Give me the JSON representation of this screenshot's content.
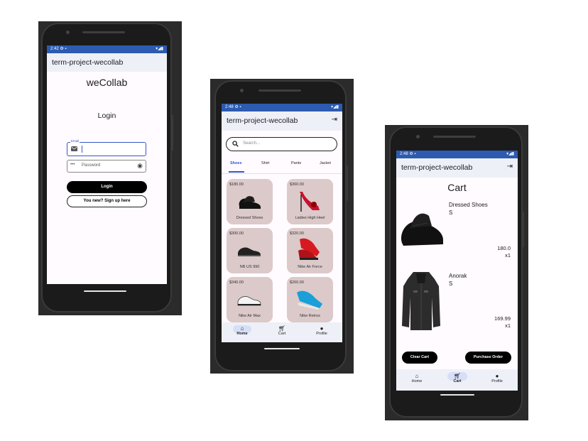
{
  "login_screen": {
    "status_time": "2:42",
    "status_icons": "▾◢▮",
    "app_title": "term-project-wecollab",
    "brand": "weCollab",
    "heading": "Login",
    "email_label": "Email",
    "password_placeholder": "Password",
    "login_button": "Login",
    "signup_button": "You new? Sign up here"
  },
  "shop_screen": {
    "status_time": "2:48",
    "status_icons": "▾◢▮",
    "app_title": "term-project-wecollab",
    "search_placeholder": "Search...",
    "tabs": [
      "Shoes",
      "Shirt",
      "Pants",
      "Jacket"
    ],
    "products": [
      {
        "price": "$180.00",
        "name": "Dressed Shoes"
      },
      {
        "price": "$360.00",
        "name": "Ladies High Heel"
      },
      {
        "price": "$300.00",
        "name": "NB US 990"
      },
      {
        "price": "$320.00",
        "name": "Nike Air Force"
      },
      {
        "price": "$340.00",
        "name": "Nike Air Max"
      },
      {
        "price": "$260.00",
        "name": "Nike Retros"
      }
    ],
    "nav": [
      "Home",
      "Cart",
      "Profile"
    ],
    "active_nav": "Home"
  },
  "cart_screen": {
    "status_time": "2:48",
    "status_icons": "▾◢▮",
    "app_title": "term-project-wecollab",
    "heading": "Cart",
    "items": [
      {
        "name": "Dressed Shoes",
        "size": "S",
        "price": "180.0",
        "qty": "x1"
      },
      {
        "name": "Anorak",
        "size": "S",
        "price": "169.99",
        "qty": "x1"
      }
    ],
    "clear_button": "Clear Cart",
    "purchase_button": "Purchase Order",
    "nav": [
      "Home",
      "Cart",
      "Profile"
    ],
    "active_nav": "Cart"
  },
  "colors": {
    "statusbar": "#2c5bb0",
    "appbar": "#eef0f8",
    "card": "#dcc9c9",
    "accent": "#3558c8",
    "nav_pill": "#d7def7"
  }
}
